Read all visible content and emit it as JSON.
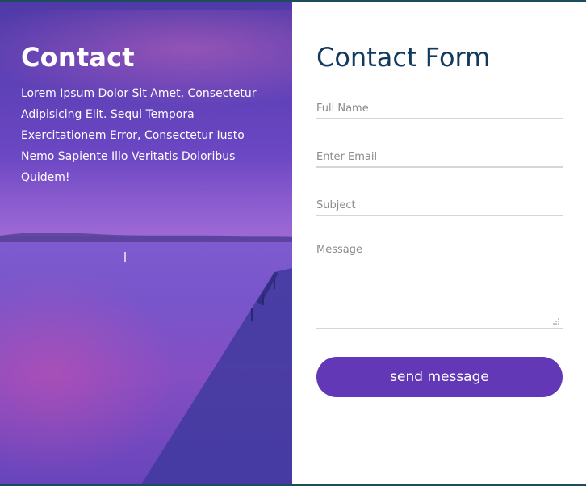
{
  "left": {
    "title": "Contact",
    "text": "Lorem Ipsum Dolor Sit Amet, Consectetur Adipisicing Elit. Sequi Tempora Exercitationem Error, Consectetur Iusto Nemo Sapiente Illo Veritatis Doloribus Quidem!"
  },
  "form": {
    "title": "Contact Form",
    "full_name_placeholder": "Full Name",
    "email_placeholder": "Enter Email",
    "subject_placeholder": "Subject",
    "message_placeholder": "Message",
    "submit_label": "send message"
  },
  "colors": {
    "accent": "#6238b6",
    "heading": "#123a5e"
  }
}
